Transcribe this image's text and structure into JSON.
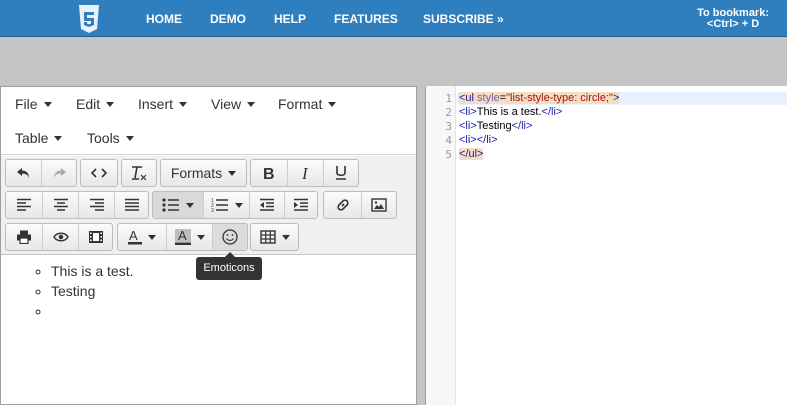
{
  "nav": {
    "links": [
      "HOME",
      "DEMO",
      "HELP",
      "FEATURES",
      "SUBSCRIBE »"
    ],
    "bookmark_line1": "To bookmark:",
    "bookmark_line2": "<Ctrl> + D"
  },
  "menubar": {
    "row1": [
      "File",
      "Edit",
      "Insert",
      "View",
      "Format"
    ],
    "row2": [
      "Table",
      "Tools"
    ]
  },
  "toolbar": {
    "formats_label": "Formats",
    "icons": [
      "undo-icon",
      "redo-icon",
      "source-code-icon",
      "clear-formatting-icon",
      "bold-icon",
      "italic-icon",
      "underline-icon",
      "align-left-icon",
      "align-center-icon",
      "align-right-icon",
      "justify-icon",
      "bullet-list-icon",
      "numbered-list-icon",
      "outdent-icon",
      "indent-icon",
      "link-icon",
      "image-icon",
      "print-icon",
      "preview-icon",
      "media-icon",
      "text-color-icon",
      "background-color-icon",
      "emoticons-icon",
      "table-icon"
    ]
  },
  "tooltip": "Emoticons",
  "content": {
    "items": [
      "This is a test.",
      "Testing",
      ""
    ]
  },
  "code": {
    "line_numbers": [
      "1",
      "2",
      "3",
      "4",
      "5"
    ],
    "line1": {
      "open": "<ul ",
      "attr": "style",
      "eq": "=",
      "val": "\"list-style-type: circle;\"",
      "close": ">"
    },
    "line2": {
      "open": "<li>",
      "text": "This is a test.",
      "close": "</li>"
    },
    "line3": {
      "open": "<li>",
      "text": "Testing",
      "close": "</li>"
    },
    "line4": {
      "open": "<li>",
      "close": "</li>"
    },
    "line5": {
      "close": "</ul>"
    }
  },
  "colors": {
    "topbar": "#2f7ebe",
    "tooltip_bg": "#333333",
    "tag": "#1a1aa6",
    "attr": "#795da3",
    "val": "#a31515"
  }
}
